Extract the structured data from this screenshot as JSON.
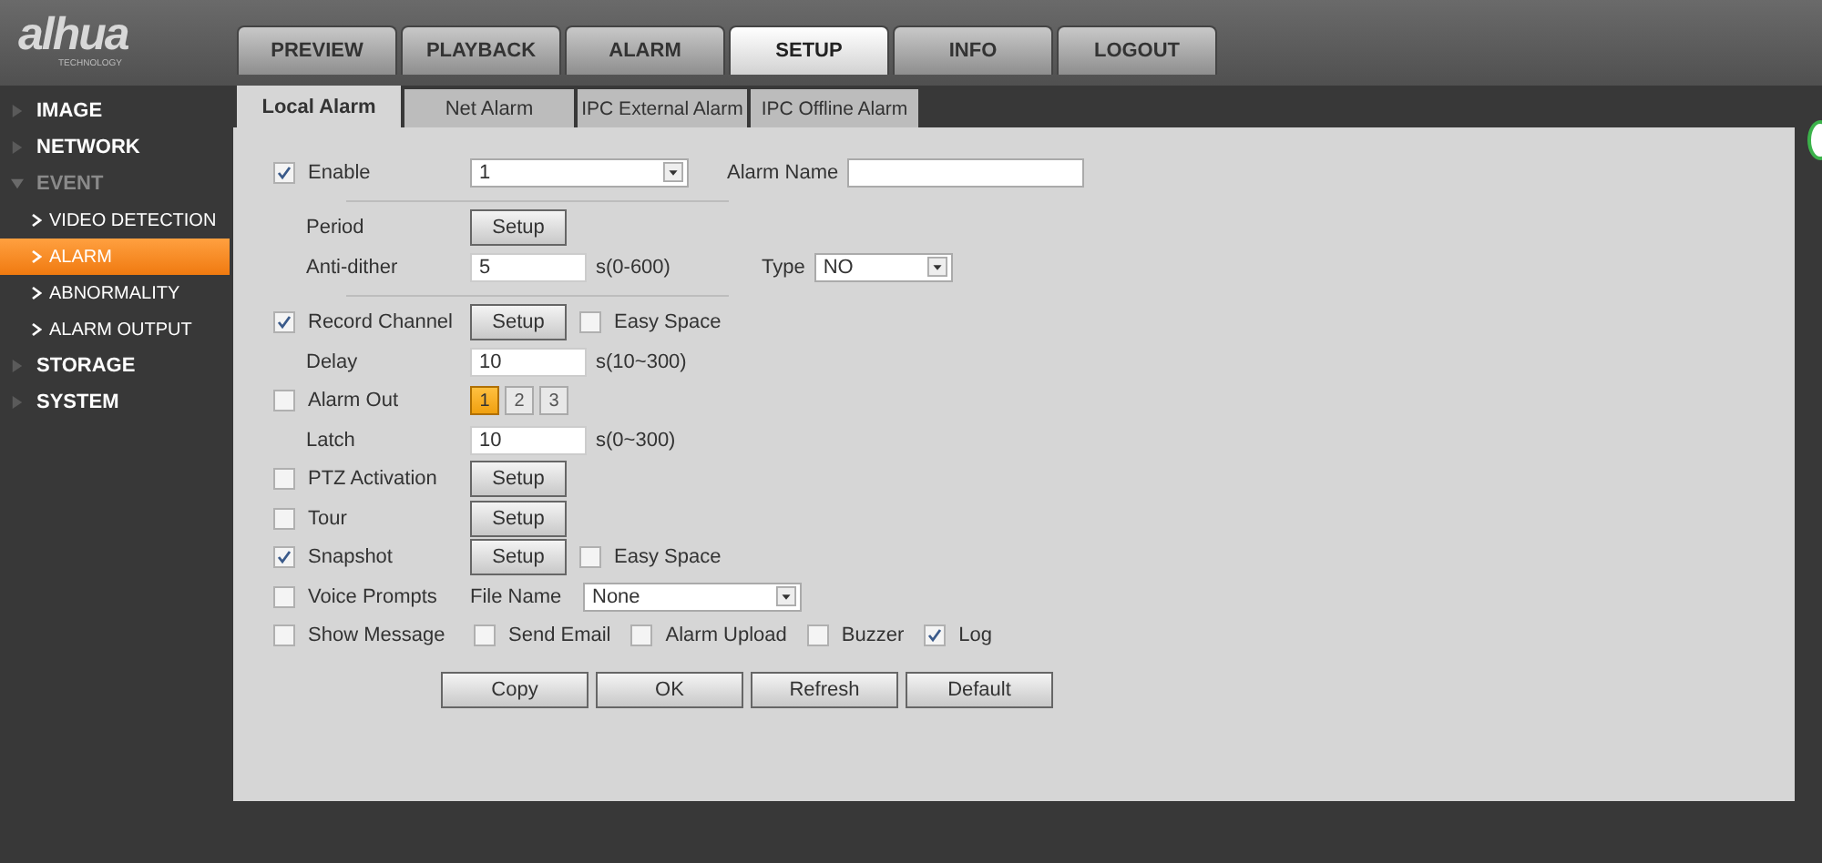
{
  "logo": {
    "name": "alhua",
    "tagline": "TECHNOLOGY"
  },
  "top_tabs": [
    {
      "label": "PREVIEW",
      "selected": false
    },
    {
      "label": "PLAYBACK",
      "selected": false
    },
    {
      "label": "ALARM",
      "selected": false
    },
    {
      "label": "SETUP",
      "selected": true
    },
    {
      "label": "INFO",
      "selected": false
    },
    {
      "label": "LOGOUT",
      "selected": false
    }
  ],
  "sidebar": {
    "items": [
      {
        "label": "IMAGE",
        "expanded": false
      },
      {
        "label": "NETWORK",
        "expanded": false
      },
      {
        "label": "EVENT",
        "expanded": true,
        "children": [
          {
            "label": "VIDEO DETECTION",
            "selected": false
          },
          {
            "label": "ALARM",
            "selected": true
          },
          {
            "label": "ABNORMALITY",
            "selected": false
          },
          {
            "label": "ALARM OUTPUT",
            "selected": false
          }
        ]
      },
      {
        "label": "STORAGE",
        "expanded": false
      },
      {
        "label": "SYSTEM",
        "expanded": false
      }
    ]
  },
  "sub_tabs": [
    {
      "label": "Local Alarm",
      "selected": true
    },
    {
      "label": "Net Alarm",
      "selected": false
    },
    {
      "label": "IPC External Alarm",
      "selected": false
    },
    {
      "label": "IPC Offline Alarm",
      "selected": false
    }
  ],
  "rows": [
    {
      "label": "Enable",
      "checked": true,
      "separator": true,
      "controls": [
        {
          "kind": "select",
          "value": "1"
        },
        {
          "kind": "side-label",
          "text": "Alarm Name"
        },
        {
          "kind": "wide-field"
        }
      ]
    },
    {
      "label": "Period",
      "controls": [
        {
          "kind": "button",
          "label": "Setup"
        }
      ]
    },
    {
      "label": "Anti-dither",
      "separator": true,
      "controls": [
        {
          "kind": "field",
          "value": "5"
        },
        {
          "kind": "unit",
          "text": "s(0-600)"
        },
        {
          "kind": "side-label",
          "text": "Type"
        },
        {
          "kind": "short-select",
          "value": "NO"
        }
      ]
    },
    {
      "label": "Record Channel",
      "checked": true,
      "controls": [
        {
          "kind": "button",
          "label": "Setup"
        },
        {
          "kind": "check",
          "label": "Easy Space",
          "checked": false
        }
      ]
    },
    {
      "label": "Delay",
      "controls": [
        {
          "kind": "field",
          "value": "10"
        },
        {
          "kind": "unit",
          "text": "s(10~300)"
        }
      ]
    },
    {
      "label": "Alarm Out",
      "checked": false,
      "controls": [
        {
          "kind": "outputs",
          "items": [
            {
              "label": "1",
              "selected": true
            },
            {
              "label": "2",
              "selected": false
            },
            {
              "label": "3",
              "selected": false
            }
          ]
        }
      ]
    },
    {
      "label": "Latch",
      "controls": [
        {
          "kind": "field",
          "value": "10"
        },
        {
          "kind": "unit",
          "text": "s(0~300)"
        }
      ]
    },
    {
      "label": "PTZ Activation",
      "checked": false,
      "controls": [
        {
          "kind": "button",
          "label": "Setup"
        }
      ]
    },
    {
      "label": "Tour",
      "checked": false,
      "controls": [
        {
          "kind": "button",
          "label": "Setup"
        }
      ]
    },
    {
      "label": "Snapshot",
      "checked": true,
      "controls": [
        {
          "kind": "button",
          "label": "Setup"
        },
        {
          "kind": "check",
          "label": "Easy Space",
          "checked": false
        }
      ]
    },
    {
      "label": "Voice Prompts",
      "checked": false,
      "controls": [
        {
          "kind": "label",
          "text": "File Name"
        },
        {
          "kind": "select",
          "value": "None"
        }
      ]
    },
    {
      "label": "Show Message",
      "checked": false,
      "controls": [
        {
          "kind": "check",
          "label": "Send Email",
          "checked": false
        },
        {
          "kind": "check",
          "label": "Alarm Upload",
          "checked": false
        },
        {
          "kind": "check",
          "label": "Buzzer",
          "checked": false
        },
        {
          "kind": "check",
          "label": "Log",
          "checked": true
        }
      ]
    }
  ],
  "buttons": [
    "Copy",
    "OK",
    "Refresh",
    "Default"
  ]
}
